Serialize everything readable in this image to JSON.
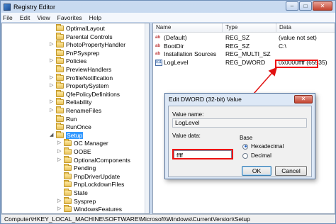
{
  "window": {
    "title": "Registry Editor",
    "minimize": "–",
    "maximize": "□",
    "close": "✕"
  },
  "menu": [
    "File",
    "Edit",
    "View",
    "Favorites",
    "Help"
  ],
  "tree": {
    "items": [
      {
        "label": "OptimalLayout",
        "expander": ""
      },
      {
        "label": "Parental Controls",
        "expander": ""
      },
      {
        "label": "PhotoPropertyHandler",
        "expander": "▷"
      },
      {
        "label": "PnPSysprep",
        "expander": ""
      },
      {
        "label": "Policies",
        "expander": "▷"
      },
      {
        "label": "PreviewHandlers",
        "expander": ""
      },
      {
        "label": "ProfileNotification",
        "expander": "▷"
      },
      {
        "label": "PropertySystem",
        "expander": "▷"
      },
      {
        "label": "QfePolicyDefinitions",
        "expander": ""
      },
      {
        "label": "Reliability",
        "expander": "▷"
      },
      {
        "label": "RenameFiles",
        "expander": "▷"
      },
      {
        "label": "Run",
        "expander": ""
      },
      {
        "label": "RunOnce",
        "expander": ""
      },
      {
        "label": "Setup",
        "expander": "◢",
        "selected": true
      },
      {
        "label": "OC Manager",
        "expander": "▷"
      },
      {
        "label": "OOBE",
        "expander": "▷"
      },
      {
        "label": "OptionalComponents",
        "expander": "▷"
      },
      {
        "label": "Pending",
        "expander": ""
      },
      {
        "label": "PnpDriverUpdate",
        "expander": ""
      },
      {
        "label": "PnpLockdownFiles",
        "expander": ""
      },
      {
        "label": "State",
        "expander": ""
      },
      {
        "label": "Sysprep",
        "expander": "▷"
      },
      {
        "label": "WindowsFeatures",
        "expander": "▷"
      }
    ]
  },
  "columns": {
    "name": "Name",
    "type": "Type",
    "data": "Data"
  },
  "values": [
    {
      "name": "(Default)",
      "type": "REG_SZ",
      "data": "(value not set)",
      "icon": "string-value-icon",
      "glyph": "ab"
    },
    {
      "name": "BootDir",
      "type": "REG_SZ",
      "data": "C:\\",
      "icon": "string-value-icon",
      "glyph": "ab"
    },
    {
      "name": "Installation Sources",
      "type": "REG_MULTI_SZ",
      "data": "",
      "icon": "string-value-icon",
      "glyph": "ab"
    },
    {
      "name": "LogLevel",
      "type": "REG_DWORD",
      "data": "0x0000ffff (65535)",
      "icon": "dword-value-icon",
      "glyph": "011"
    }
  ],
  "statusbar": {
    "path": "Computer\\HKEY_LOCAL_MACHINE\\SOFTWARE\\Microsoft\\Windows\\CurrentVersion\\Setup"
  },
  "dialog": {
    "title": "Edit DWORD (32-bit) Value",
    "close": "✕",
    "value_name_label": "Value name:",
    "value_name": "LogLevel",
    "value_data_label": "Value data:",
    "value_data": "ffff",
    "base_label": "Base",
    "hex_label": "Hexadecimal",
    "dec_label": "Decimal",
    "ok": "OK",
    "cancel": "Cancel"
  },
  "colors": {
    "highlight": "#e11111",
    "selection": "#3399ff"
  }
}
